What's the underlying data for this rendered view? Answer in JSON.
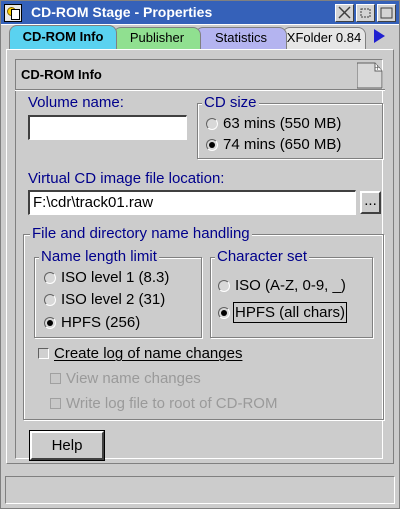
{
  "window": {
    "title": "CD-ROM Stage - Properties",
    "title_bar_color": "#3561b9"
  },
  "tabs": [
    {
      "label": "CD-ROM Info",
      "mnemonic": "I",
      "color": "#5ad2f0",
      "active": true
    },
    {
      "label": "Publisher",
      "color": "#90e090",
      "active": false
    },
    {
      "label": "Statistics",
      "mnemonic": "S",
      "color": "#b4b4f0",
      "active": false
    },
    {
      "label": "XFolder 0.84",
      "mnemonic": "X",
      "color": "#e6e6e6",
      "active": false
    }
  ],
  "page": {
    "title": "CD-ROM Info",
    "volume_name": {
      "label": "Volume name:",
      "value": ""
    },
    "cd_size": {
      "label": "CD size",
      "options": [
        "63 mins (550 MB)",
        "74 mins (650 MB)"
      ],
      "selected": 1
    },
    "image_location": {
      "label": "Virtual CD image file location:",
      "value": "F:\\cdr\\track01.raw",
      "browse_label": "..."
    },
    "file_handling": {
      "label": "File and directory name handling",
      "name_length": {
        "label": "Name length limit",
        "options": [
          "ISO level 1 (8.3)",
          "ISO level 2 (31)",
          "HPFS (256)"
        ],
        "selected": 2
      },
      "charset": {
        "label": "Character set",
        "options": [
          "ISO (A-Z, 0-9, _)",
          "HPFS (all chars)"
        ],
        "selected": 1
      },
      "create_log": {
        "label": "Create log of name changes",
        "checked": false
      },
      "view_changes": {
        "label": "View name changes",
        "checked": false,
        "enabled": false
      },
      "write_log": {
        "label": "Write log file to root of CD-ROM",
        "checked": false,
        "enabled": false
      }
    },
    "help_label": "Help"
  },
  "colors": {
    "accent_label": "#00008b",
    "dialog_bg": "#cccccc"
  }
}
